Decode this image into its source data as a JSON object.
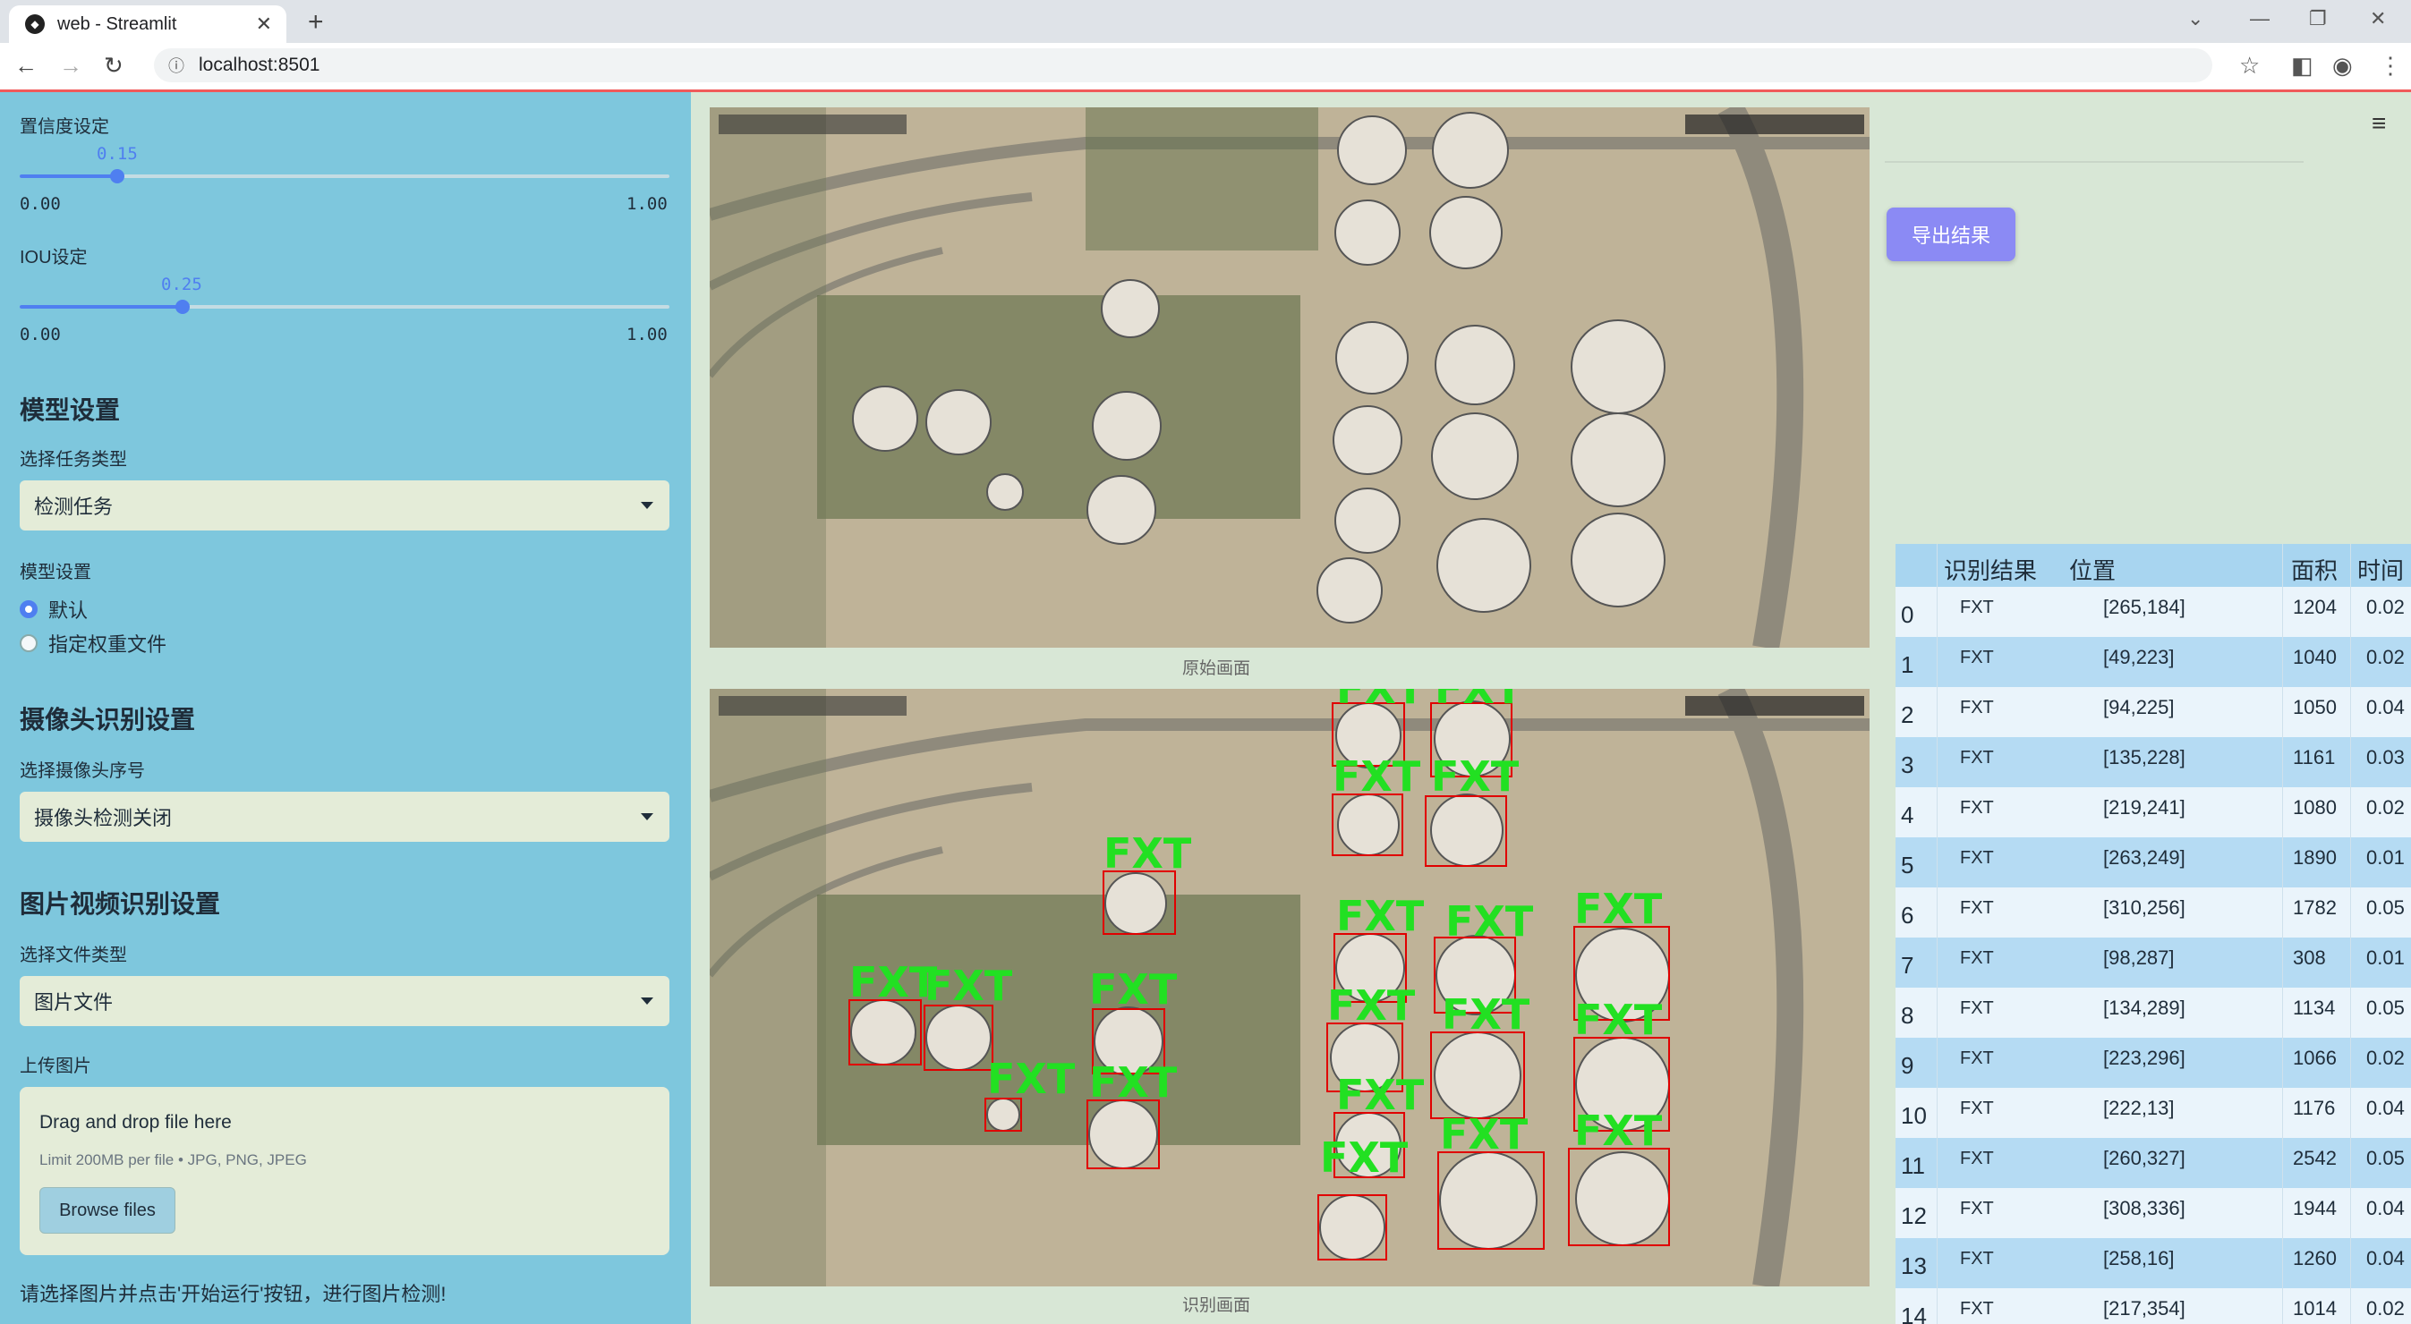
{
  "browser": {
    "tab_title": "web - Streamlit",
    "url": "localhost:8501"
  },
  "sidebar": {
    "conf": {
      "label": "置信度设定",
      "value": "0.15",
      "min": "0.00",
      "max": "1.00",
      "fraction": 0.15
    },
    "iou": {
      "label": "IOU设定",
      "value": "0.25",
      "min": "0.00",
      "max": "1.00",
      "fraction": 0.25
    },
    "model_section": "模型设置",
    "task_label": "选择任务类型",
    "task_value": "检测任务",
    "weights_label": "模型设置",
    "radio_default": "默认",
    "radio_custom": "指定权重文件",
    "camera_section": "摄像头识别设置",
    "camera_label": "选择摄像头序号",
    "camera_value": "摄像头检测关闭",
    "media_section": "图片视频识别设置",
    "filetype_label": "选择文件类型",
    "filetype_value": "图片文件",
    "upload_label": "上传图片",
    "upload_drag": "Drag and drop file here",
    "upload_limit": "Limit 200MB per file • JPG, PNG, JPEG",
    "browse_button": "Browse files",
    "hint": "请选择图片并点击'开始运行'按钮，进行图片检测!"
  },
  "main": {
    "original_caption": "原始画面",
    "result_caption": "识别画面",
    "detection_label": "FXT",
    "export_button": "导出结果"
  },
  "table": {
    "headers": [
      "识别结果",
      "位置",
      "面积",
      "时间"
    ],
    "rows": [
      {
        "idx": "0",
        "label": "FXT",
        "pos": "[265,184]",
        "area": "1204",
        "time": "0.02"
      },
      {
        "idx": "1",
        "label": "FXT",
        "pos": "[49,223]",
        "area": "1040",
        "time": "0.02"
      },
      {
        "idx": "2",
        "label": "FXT",
        "pos": "[94,225]",
        "area": "1050",
        "time": "0.04"
      },
      {
        "idx": "3",
        "label": "FXT",
        "pos": "[135,228]",
        "area": "1161",
        "time": "0.03"
      },
      {
        "idx": "4",
        "label": "FXT",
        "pos": "[219,241]",
        "area": "1080",
        "time": "0.02"
      },
      {
        "idx": "5",
        "label": "FXT",
        "pos": "[263,249]",
        "area": "1890",
        "time": "0.01"
      },
      {
        "idx": "6",
        "label": "FXT",
        "pos": "[310,256]",
        "area": "1782",
        "time": "0.05"
      },
      {
        "idx": "7",
        "label": "FXT",
        "pos": "[98,287]",
        "area": "308",
        "time": "0.01"
      },
      {
        "idx": "8",
        "label": "FXT",
        "pos": "[134,289]",
        "area": "1134",
        "time": "0.05"
      },
      {
        "idx": "9",
        "label": "FXT",
        "pos": "[223,296]",
        "area": "1066",
        "time": "0.02"
      },
      {
        "idx": "10",
        "label": "FXT",
        "pos": "[222,13]",
        "area": "1176",
        "time": "0.04"
      },
      {
        "idx": "11",
        "label": "FXT",
        "pos": "[260,327]",
        "area": "2542",
        "time": "0.05"
      },
      {
        "idx": "12",
        "label": "FXT",
        "pos": "[308,336]",
        "area": "1944",
        "time": "0.04"
      },
      {
        "idx": "13",
        "label": "FXT",
        "pos": "[258,16]",
        "area": "1260",
        "time": "0.04"
      },
      {
        "idx": "14",
        "label": "FXT",
        "pos": "[217,354]",
        "area": "1014",
        "time": "0.02"
      }
    ]
  }
}
